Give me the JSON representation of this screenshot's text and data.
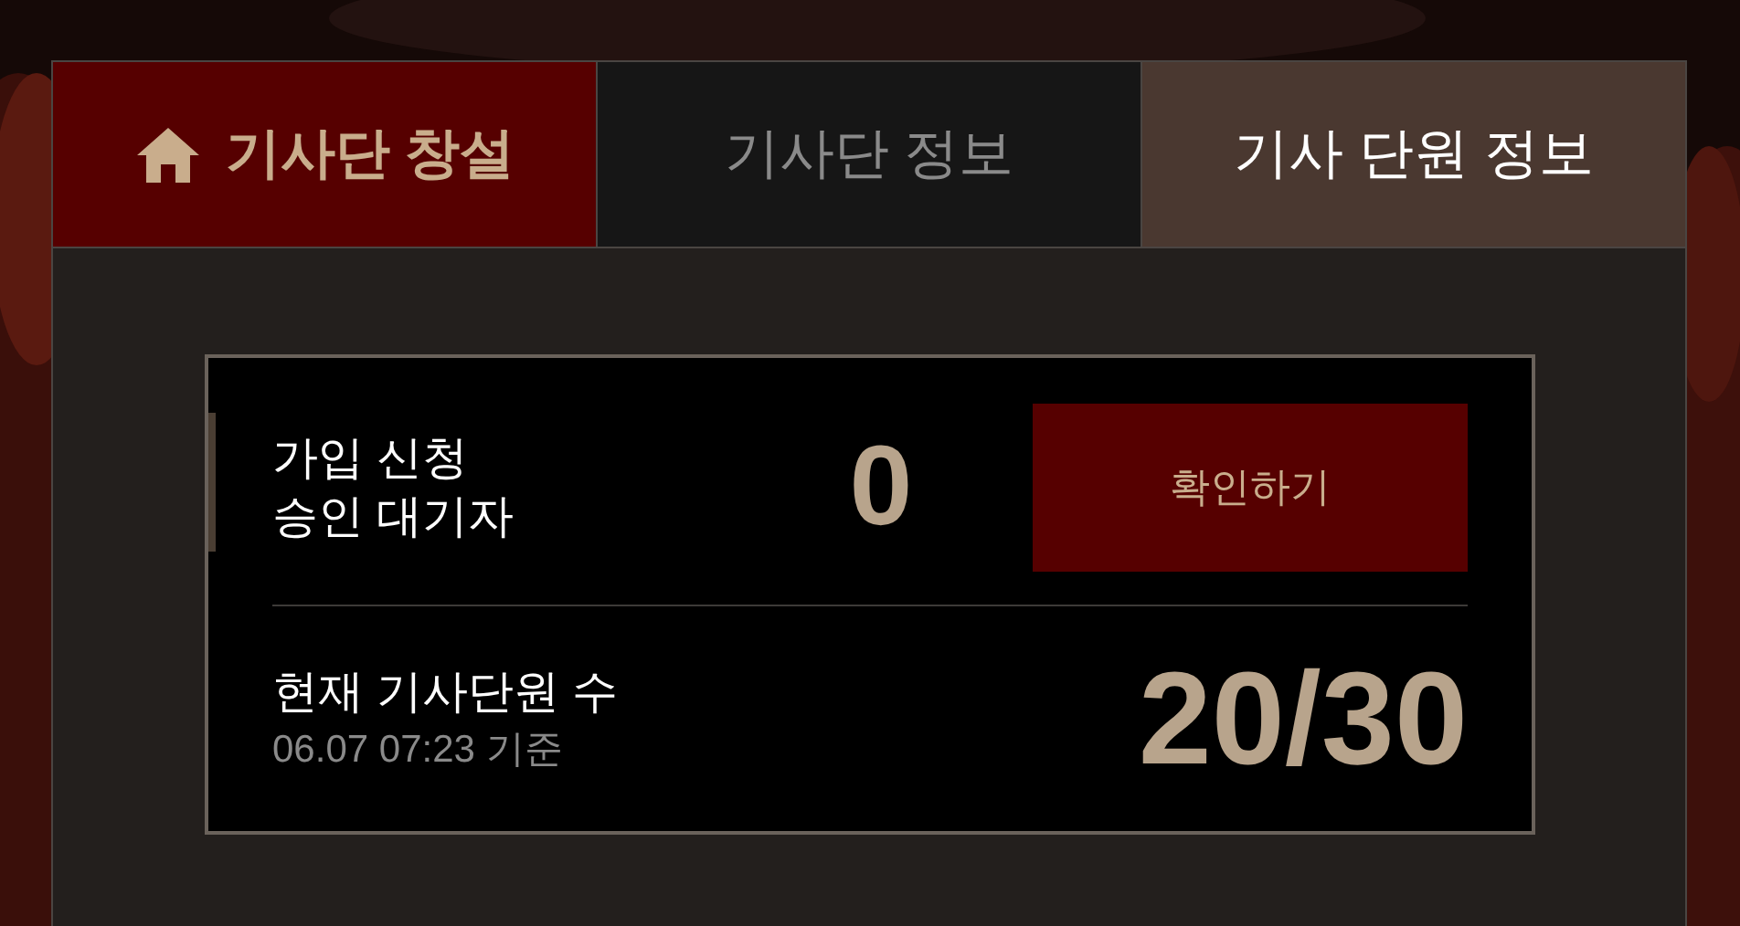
{
  "tabs": [
    {
      "label": "기사단 창설",
      "kind": "action"
    },
    {
      "label": "기사단 정보",
      "kind": "tab",
      "selected": false
    },
    {
      "label": "기사 단원 정보",
      "kind": "tab",
      "selected": true
    }
  ],
  "pending": {
    "label_lines": [
      "가입 신청",
      "승인 대기자"
    ],
    "count": "0",
    "button": "확인하기"
  },
  "members": {
    "label": "현재 기사단원 수",
    "timestamp": "06.07 07:23 기준",
    "count": "20/30"
  }
}
